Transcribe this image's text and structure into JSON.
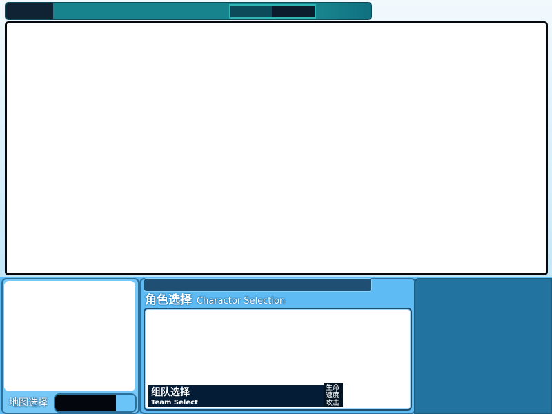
{
  "map_panel": {
    "label": "地图选择"
  },
  "character_panel": {
    "title": "角色选择",
    "subtitle": "Charactor Selection"
  },
  "team_panel": {
    "title": "组队选择",
    "subtitle": "Team Select"
  },
  "stats": {
    "labels": [
      "生命",
      "速度",
      "攻击"
    ]
  },
  "colors": {
    "top_bar": "#17838d",
    "bottom_panel": "#5ebbf3",
    "info_panel": "#22739f",
    "dark_box": "#041c35"
  }
}
